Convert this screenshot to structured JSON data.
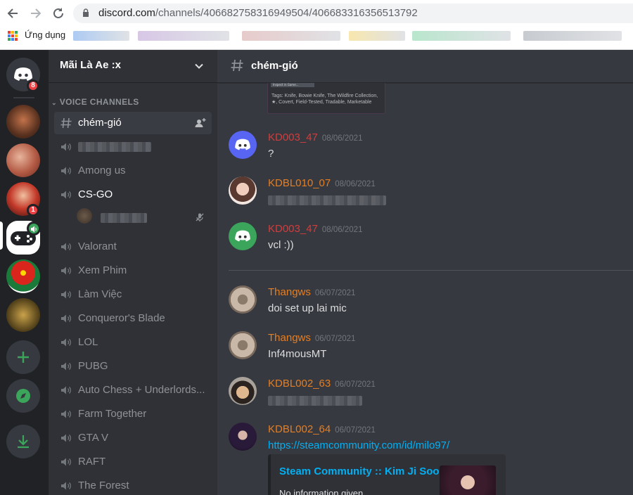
{
  "browser": {
    "url_domain": "discord.com",
    "url_path": "/channels/406682758316949504/406683316356513792",
    "apps_label": "Ứng dụng",
    "icons": [
      "back-arrow-icon",
      "forward-arrow-icon",
      "reload-icon",
      "lock-icon",
      "apps-grid-icon"
    ]
  },
  "guilds": {
    "home_badge": "8",
    "guild3_badge": "1",
    "icons": [
      "discord-home-icon",
      "add-server-icon",
      "explore-compass-icon",
      "download-icon",
      "speaker-icon"
    ]
  },
  "sidebar": {
    "server_name": "Mãi Là Ae :x",
    "category": "VOICE CHANNELS",
    "selected_channel": "chém-gió",
    "channels": [
      "Among us",
      "CS-GO",
      "Valorant",
      "Xem Phim",
      "Làm Việc",
      "Conqueror's Blade",
      "LOL",
      "PUBG",
      "Auto Chess + Underlords...",
      "Farm Together",
      "GTA V",
      "RAFT",
      "The Forest"
    ]
  },
  "channel": {
    "name": "chém-gió"
  },
  "embed_top": {
    "button_text": "Inspect in Game...",
    "tags": "Tags: Knife, Bowie Knife, The Wildfire Collection, ★, Covert, Field-Tested, Tradable, Marketable"
  },
  "messages": [
    {
      "user": "KD003_47",
      "time": "08/06/2021",
      "text": "?",
      "color": "#d13d3d"
    },
    {
      "user": "KDBL010_07",
      "time": "08/06/2021",
      "text": "",
      "color": "#e67e22"
    },
    {
      "user": "KD003_47",
      "time": "08/06/2021",
      "text": "vcl :))",
      "color": "#d13d3d"
    },
    {
      "user": "Thangws",
      "time": "06/07/2021",
      "text": "doi set up lai mic",
      "color": "#e67e22"
    },
    {
      "user": "Thangws",
      "time": "06/07/2021",
      "text": "Inf4mousMT",
      "color": "#e67e22"
    },
    {
      "user": "KDBL002_63",
      "time": "06/07/2021",
      "text": "",
      "color": "#e67e22"
    },
    {
      "user": "KDBL002_64",
      "time": "06/07/2021",
      "text": "https://steamcommunity.com/id/milo97/",
      "color": "#e67e22"
    }
  ],
  "steam_embed": {
    "title": "Steam Community :: Kim Ji Soo",
    "description": "No information given."
  },
  "colors": {
    "accent_blurple": "#5865f2",
    "online_green": "#3ba55c",
    "link_blue": "#00b0f4",
    "badge_red": "#ed4245"
  }
}
